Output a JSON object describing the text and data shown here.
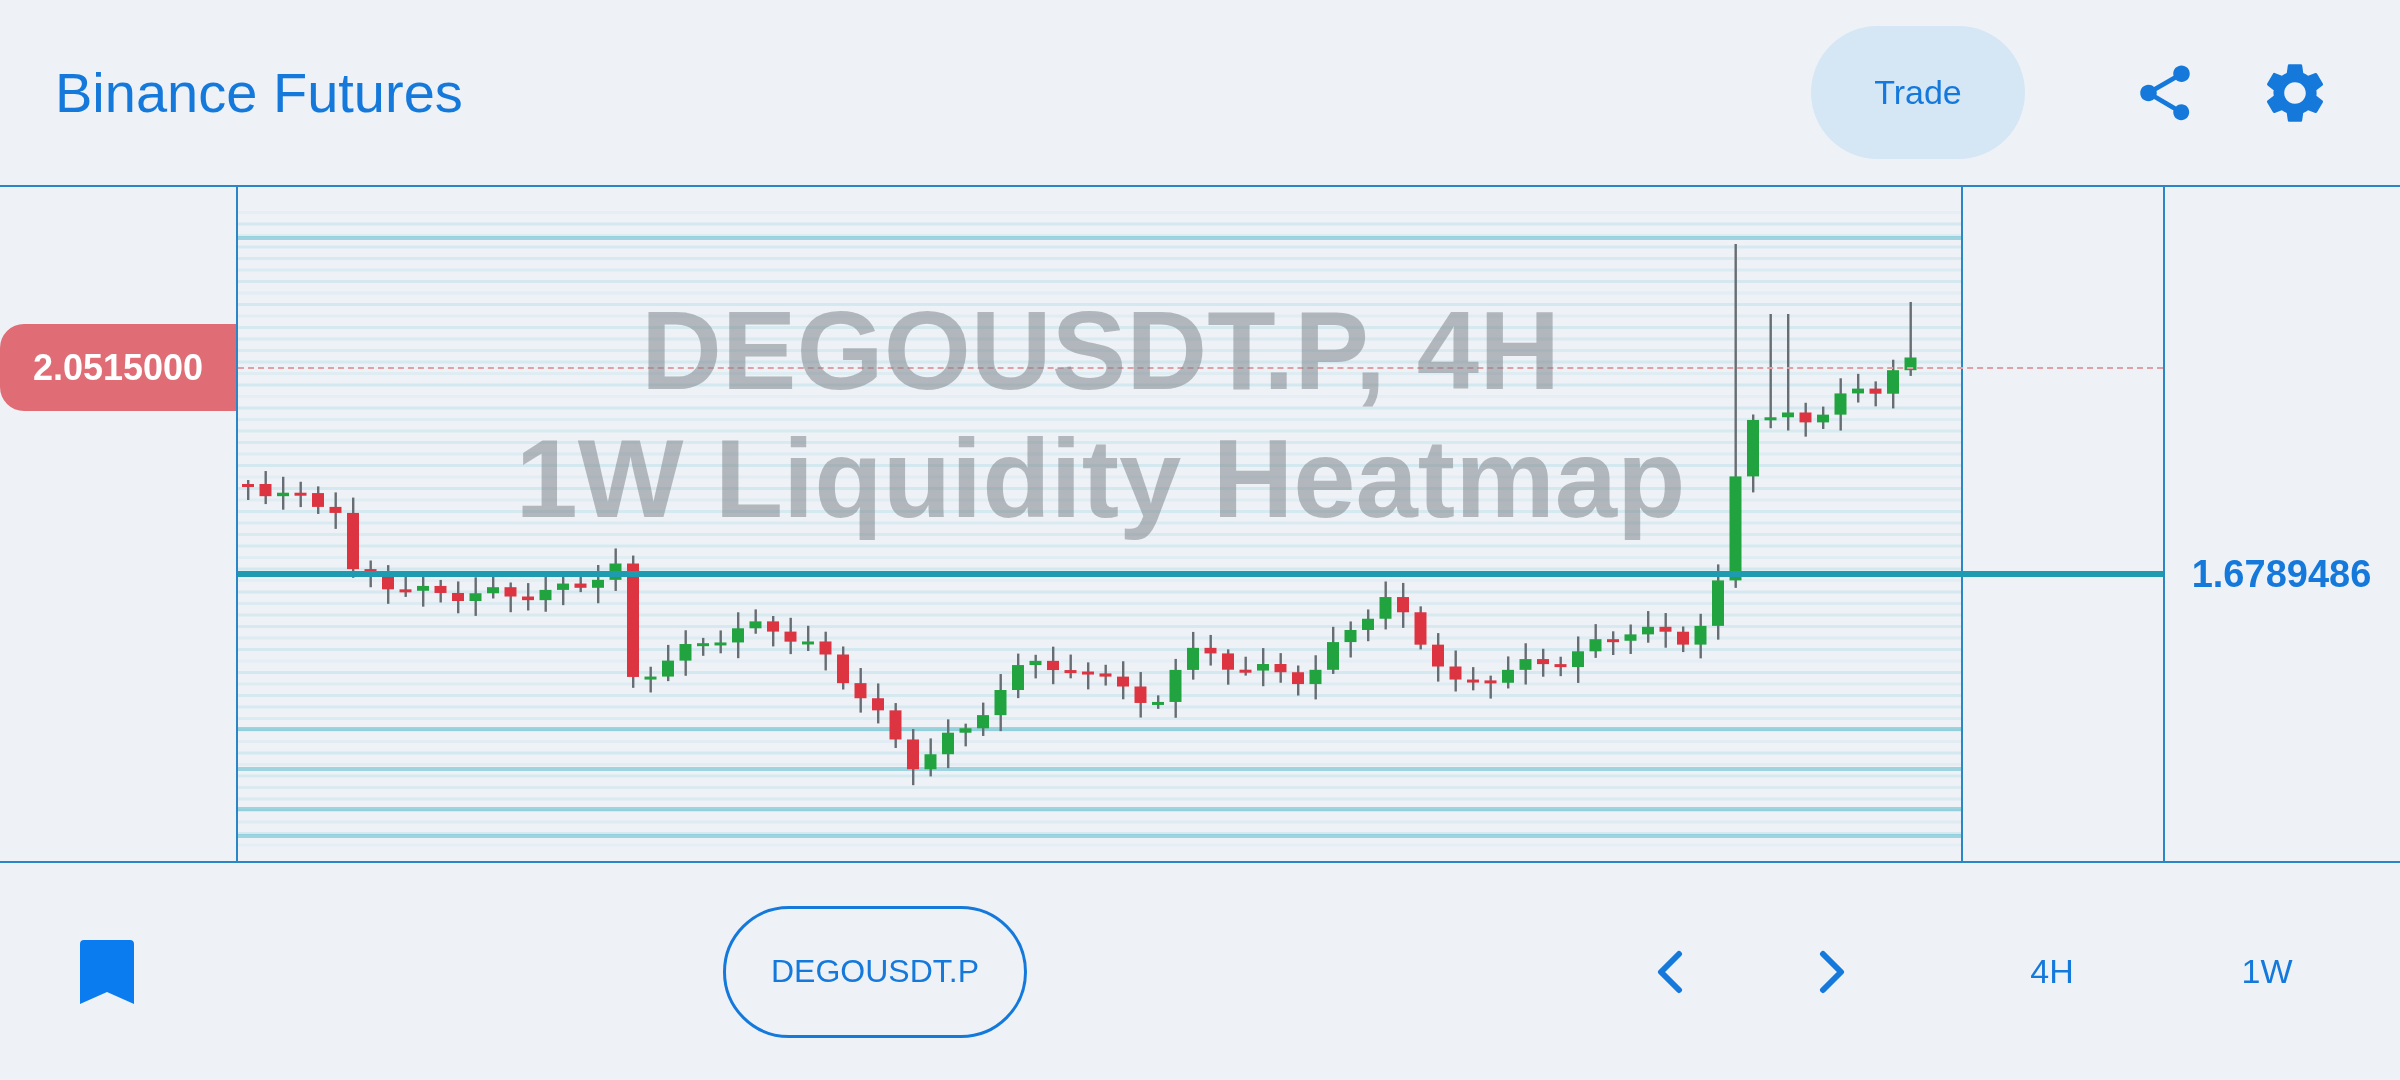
{
  "header": {
    "title": "Binance Futures",
    "trade_button": "Trade"
  },
  "chart": {
    "watermark": [
      "DEGOUSDT.P, 4H",
      "1W Liquidity Heatmap"
    ],
    "current_price": "2.0515000",
    "level_price": "1.6789486"
  },
  "bottom_bar": {
    "symbol": "DEGOUSDT.P",
    "timeframes": [
      "4H",
      "1W"
    ]
  }
}
